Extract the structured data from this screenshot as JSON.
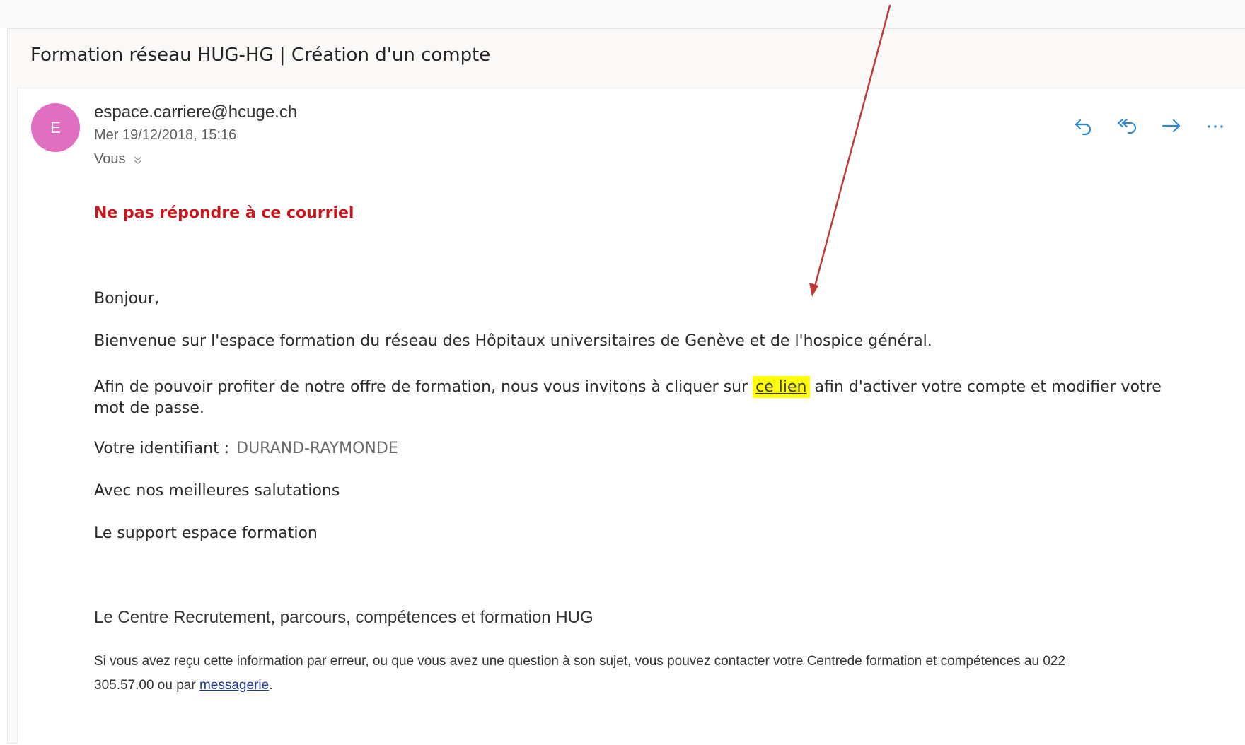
{
  "email": {
    "subject": "Formation réseau HUG-HG | Création d'un compte",
    "avatar_letter": "E",
    "sender": "espace.carriere@hcuge.ch",
    "date": "Mer 19/12/2018, 15:16",
    "recipient": "Vous",
    "actions": [
      "reply-icon",
      "reply-all-icon",
      "forward-icon",
      "more-icon"
    ],
    "accent_color": "#2b88d8",
    "avatar_color": "#e06fc1",
    "warning_color": "#c8171c",
    "highlight_color": "#ffff00"
  },
  "body": {
    "warning": "Ne pas répondre à ce courriel",
    "greeting": "Bonjour,",
    "welcome": "Bienvenue sur l'espace formation du réseau des Hôpitaux universitaires de Genève et de l'hospice général.",
    "paragraph_before_link": "Afin de pouvoir profiter de notre offre de formation, nous vous invitons à cliquer sur ",
    "link_text": "ce lien",
    "paragraph_after_link": " afin d'activer votre compte et modifier votre",
    "paragraph_continuation": "mot de passe.",
    "identifier_label": "Votre identifiant :",
    "identifier_value": "DURAND-RAYMONDE",
    "salutation": "Avec nos meilleures salutations",
    "support": "Le support espace formation",
    "centre": "Le Centre Recrutement, parcours, compétences et formation HUG",
    "footer_line1": "Si vous avez reçu cette information par erreur, ou que vous avez une question à son sujet, vous pouvez contacter votre Centrede formation et compétences au 022",
    "footer_line2_before": "305.57.00 ou par ",
    "footer_link": "messagerie",
    "footer_line2_after": "."
  },
  "annotation": {
    "arrow_color": "#c0393b"
  }
}
